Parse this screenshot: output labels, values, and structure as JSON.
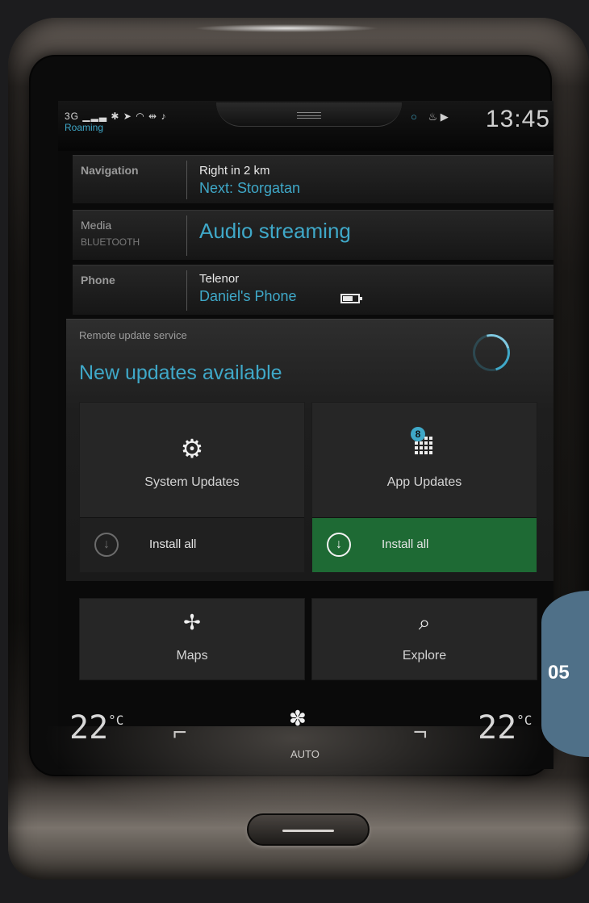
{
  "status_bar": {
    "signal": "3G",
    "roaming": "Roaming",
    "clock": "13:45"
  },
  "rows": {
    "navigation": {
      "label": "Navigation",
      "instruction": "Right in 2 km",
      "next": "Next: Storgatan"
    },
    "media": {
      "label": "Media",
      "source": "BLUETOOTH",
      "title": "Audio streaming"
    },
    "phone": {
      "label": "Phone",
      "carrier": "Telenor",
      "device": "Daniel's Phone"
    }
  },
  "update_service": {
    "title": "Remote update service",
    "headline": "New updates available",
    "system_updates_label": "System Updates",
    "app_updates_label": "App Updates",
    "app_updates_badge": "8",
    "install_all_system": "Install all",
    "install_all_apps": "Install all"
  },
  "apps": {
    "maps": "Maps",
    "explore": "Explore"
  },
  "climate": {
    "left_temp": "22",
    "right_temp": "22",
    "unit": "°C",
    "mode": "AUTO"
  },
  "chapter": "05",
  "colors": {
    "accent": "#3fa8c8",
    "install_active": "#1e6a34",
    "chapter_tab": "#4f7088"
  },
  "icons": {
    "system_updates": "gear-icon",
    "app_updates": "app-grid-icon",
    "install": "download-arrow-icon",
    "maps": "compass-icon",
    "explore": "search-icon",
    "fan": "fan-icon",
    "seat": "seat-heating-icon",
    "battery": "battery-icon"
  }
}
